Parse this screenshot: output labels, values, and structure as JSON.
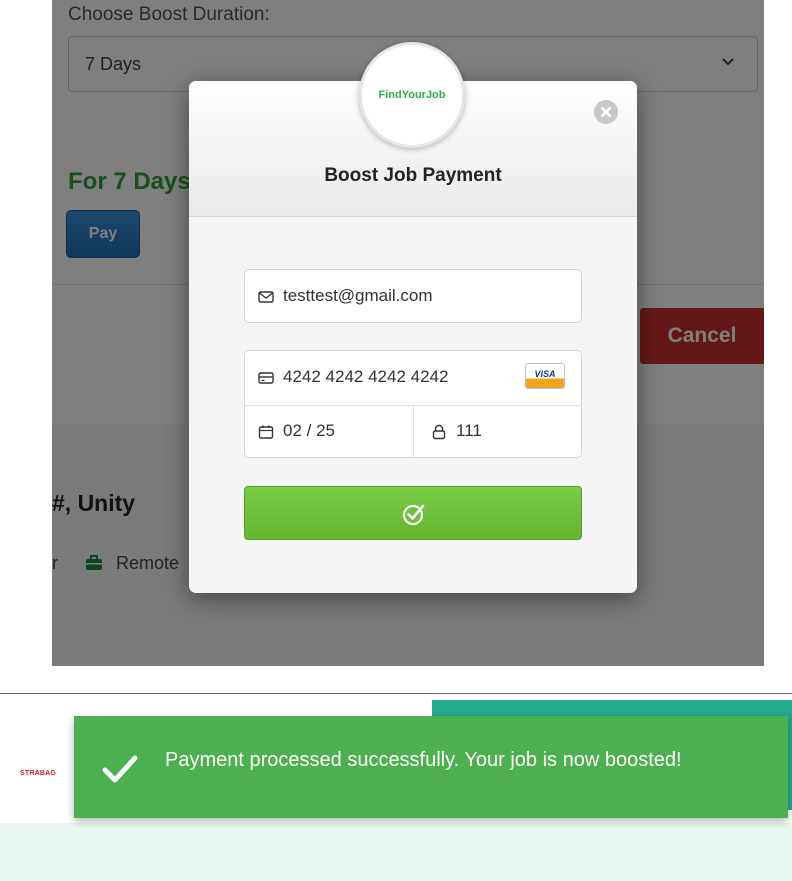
{
  "background_page": {
    "duration_label": "Choose Boost Duration:",
    "duration_value": "7 Days",
    "price_text": "For 7 Days",
    "pay_button": "Pay",
    "cancel_button": "Cancel",
    "job_title": "#, Unity",
    "meta_prefix": "r",
    "meta_type": "Remote"
  },
  "payment_modal": {
    "logo_text": "FindYourJob",
    "title": "Boost Job Payment",
    "email": "testtest@gmail.com",
    "card_number": "4242 4242 4242 4242",
    "card_brand": "VISA",
    "expiry": "02 / 25",
    "cvc": "111",
    "icons": {
      "email": "envelope-icon",
      "card": "credit-card-icon",
      "expiry": "calendar-icon",
      "cvc": "lock-icon",
      "submit": "check-circle-icon",
      "close": "close-icon"
    }
  },
  "toast": {
    "message": "Payment processed successfully. Your job is now boosted!",
    "color": "#4caf50"
  },
  "company_logo_text": "STRABAG",
  "colors": {
    "accent_green": "#2e9e3e",
    "pay_blue": "#1f6fb6",
    "cancel_red": "#c9302c",
    "submit_green": "#6cc03a",
    "teal": "#23ad8a"
  }
}
